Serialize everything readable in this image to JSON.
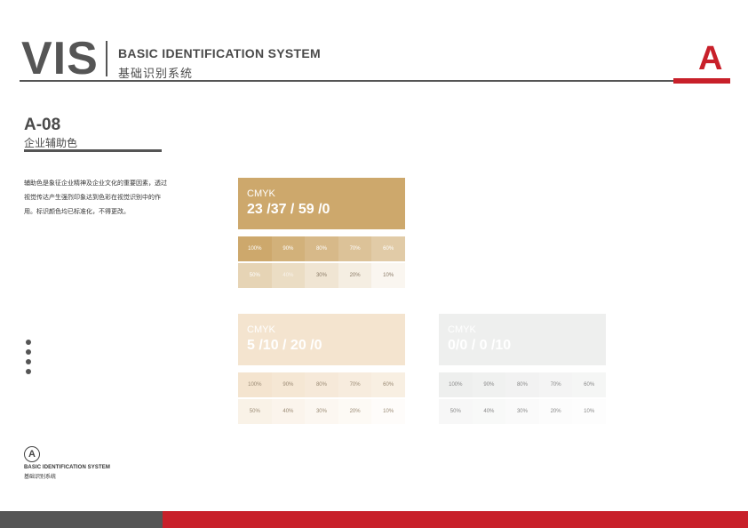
{
  "header": {
    "vis": "VIS",
    "title_en": "BASIC IDENTIFICATION SYSTEM",
    "title_cn": "基础识别系统",
    "section_letter": "A"
  },
  "section": {
    "code": "A-08",
    "title": "企业辅助色",
    "description": "辅助色是象征企业精神及企业文化的重要因素，透过视觉传达产生强烈印象达到色彩在视觉识别中的作用。标识颜色均已标准化，不得更改。"
  },
  "colors": {
    "accent_red": "#c8202a",
    "dark_gray": "#555555",
    "gold": "#cda86c",
    "beige": "#f4e4cf",
    "light_gray": "#eeefee"
  },
  "swatches": [
    {
      "label": "CMYK",
      "values": "23 /37 / 59 /0",
      "tints_top": [
        "100%",
        "90%",
        "80%",
        "70%",
        "60%"
      ],
      "tints_bottom": [
        "50%",
        "40%",
        "30%",
        "20%",
        "10%"
      ]
    },
    {
      "label": "CMYK",
      "values": "5 /10 / 20 /0",
      "tints_top": [
        "100%",
        "90%",
        "80%",
        "70%",
        "60%"
      ],
      "tints_bottom": [
        "50%",
        "40%",
        "30%",
        "20%",
        "10%"
      ]
    },
    {
      "label": "CMYK",
      "values": "0/0 / 0 /10",
      "tints_top": [
        "100%",
        "90%",
        "80%",
        "70%",
        "60%"
      ],
      "tints_bottom": [
        "50%",
        "40%",
        "30%",
        "20%",
        "10%"
      ]
    }
  ],
  "footer": {
    "logo_letter": "A",
    "logo_en": "BASIC IDENTIFICATION SYSTEM",
    "logo_cn": "基础识别系统"
  }
}
